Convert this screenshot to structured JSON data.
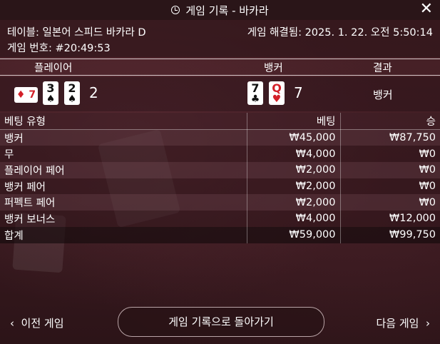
{
  "title": "게임 기록 - 바카라",
  "info": {
    "table": "테이블: 일본어 스피드 바카라 D",
    "game_number": "게임 번호: #20:49:53",
    "resolved": "게임 해결됨: 2025. 1. 22. 오전 5:50:14"
  },
  "hands": {
    "player_label": "플레이어",
    "banker_label": "뱅커",
    "result_label": "결과",
    "player_cards": [
      {
        "rank": "7",
        "suit": "♦",
        "color": "#d32029",
        "orientation": "sideways"
      },
      {
        "rank": "3",
        "suit": "♠",
        "color": "#111111"
      },
      {
        "rank": "2",
        "suit": "♠",
        "color": "#111111"
      }
    ],
    "player_score": "2",
    "banker_cards": [
      {
        "rank": "7",
        "suit": "♣",
        "color": "#111111"
      },
      {
        "rank": "Q",
        "suit": "♥",
        "color": "#d32029"
      }
    ],
    "banker_score": "7",
    "result": "뱅커"
  },
  "bets": {
    "headers": [
      "베팅 유형",
      "베팅",
      "승"
    ],
    "rows": [
      {
        "type": "뱅커",
        "bet": "₩45,000",
        "win": "₩87,750"
      },
      {
        "type": "무",
        "bet": "₩4,000",
        "win": "₩0"
      },
      {
        "type": "플레이어 페어",
        "bet": "₩2,000",
        "win": "₩0"
      },
      {
        "type": "뱅커 페어",
        "bet": "₩2,000",
        "win": "₩0"
      },
      {
        "type": "퍼펙트 페어",
        "bet": "₩2,000",
        "win": "₩0"
      },
      {
        "type": "뱅커 보너스",
        "bet": "₩4,000",
        "win": "₩12,000"
      }
    ],
    "total": {
      "type": "합계",
      "bet": "₩59,000",
      "win": "₩99,750"
    }
  },
  "footer": {
    "prev": "이전 게임",
    "back": "게임 기록으로 돌아가기",
    "next": "다음 게임"
  },
  "icons": {
    "close": "close-icon",
    "history": "history-clock-icon",
    "prev": "chevron-left-icon",
    "next": "chevron-right-icon"
  }
}
